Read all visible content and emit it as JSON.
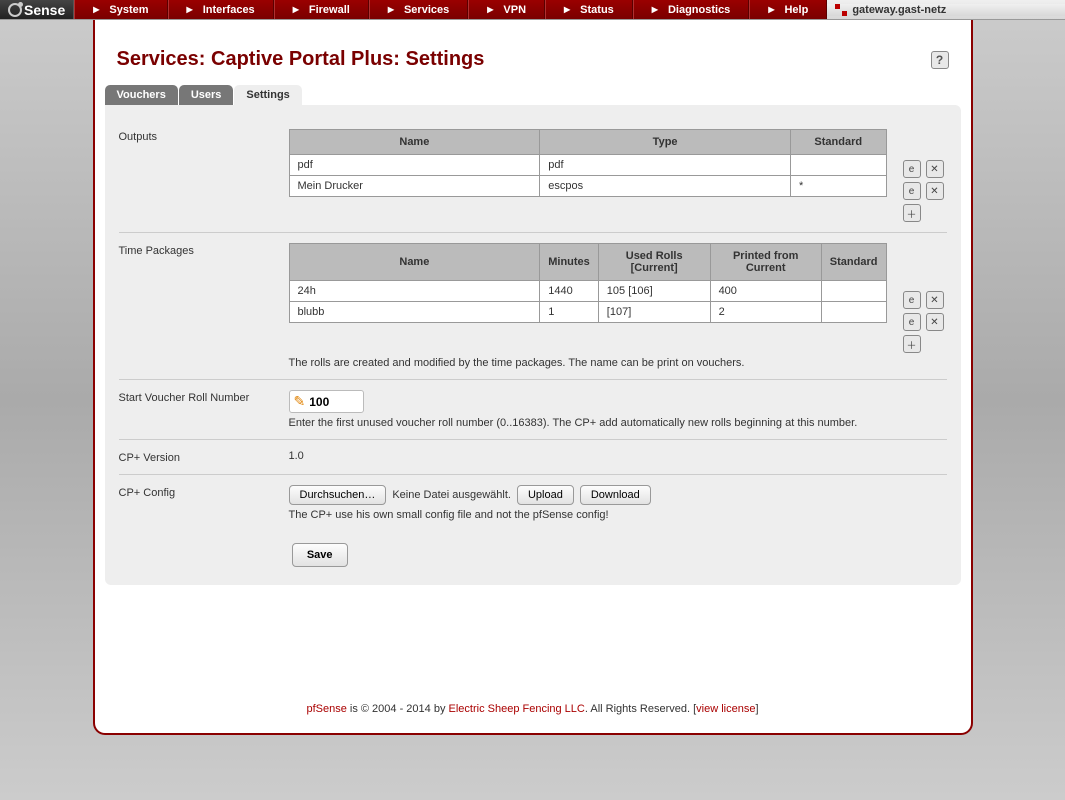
{
  "logo": "Sense",
  "nav": [
    "System",
    "Interfaces",
    "Firewall",
    "Services",
    "VPN",
    "Status",
    "Diagnostics",
    "Help"
  ],
  "hostname": "gateway.gast-netz",
  "title": "Services: Captive Portal Plus: Settings",
  "tabs": {
    "vouchers": "Vouchers",
    "users": "Users",
    "settings": "Settings"
  },
  "sections": {
    "outputs": {
      "label": "Outputs",
      "headers": {
        "name": "Name",
        "type": "Type",
        "standard": "Standard"
      },
      "rows": [
        {
          "name": "pdf",
          "type": "pdf",
          "standard": ""
        },
        {
          "name": "Mein Drucker",
          "type": "escpos",
          "standard": "*"
        }
      ]
    },
    "timepkg": {
      "label": "Time Packages",
      "headers": {
        "name": "Name",
        "minutes": "Minutes",
        "usedrolls": "Used Rolls [Current]",
        "printed": "Printed from Current",
        "standard": "Standard"
      },
      "rows": [
        {
          "name": "24h",
          "minutes": "1440",
          "usedrolls": "105  [106]",
          "printed": "400",
          "standard": ""
        },
        {
          "name": "blubb",
          "minutes": "1",
          "usedrolls": "[107]",
          "printed": "2",
          "standard": ""
        }
      ],
      "hint": "The rolls are created and modified by the time packages. The name can be print on vouchers."
    },
    "startroll": {
      "label": "Start Voucher Roll Number",
      "value": "100",
      "hint": "Enter the first unused voucher roll number (0..16383). The CP+ add automatically new rolls beginning at this number."
    },
    "version": {
      "label": "CP+ Version",
      "value": "1.0"
    },
    "config": {
      "label": "CP+ Config",
      "browse": "Durchsuchen…",
      "nofile": "Keine Datei ausgewählt.",
      "upload": "Upload",
      "download": "Download",
      "hint": "The CP+ use his own small config file and not the pfSense config!"
    }
  },
  "save": "Save",
  "footer": {
    "prefix": "pfSense",
    "mid": " is © 2004 - 2014 by ",
    "company": "Electric Sheep Fencing LLC",
    "suffix": ". All Rights Reserved. [",
    "license": "view license",
    "end": "]"
  }
}
